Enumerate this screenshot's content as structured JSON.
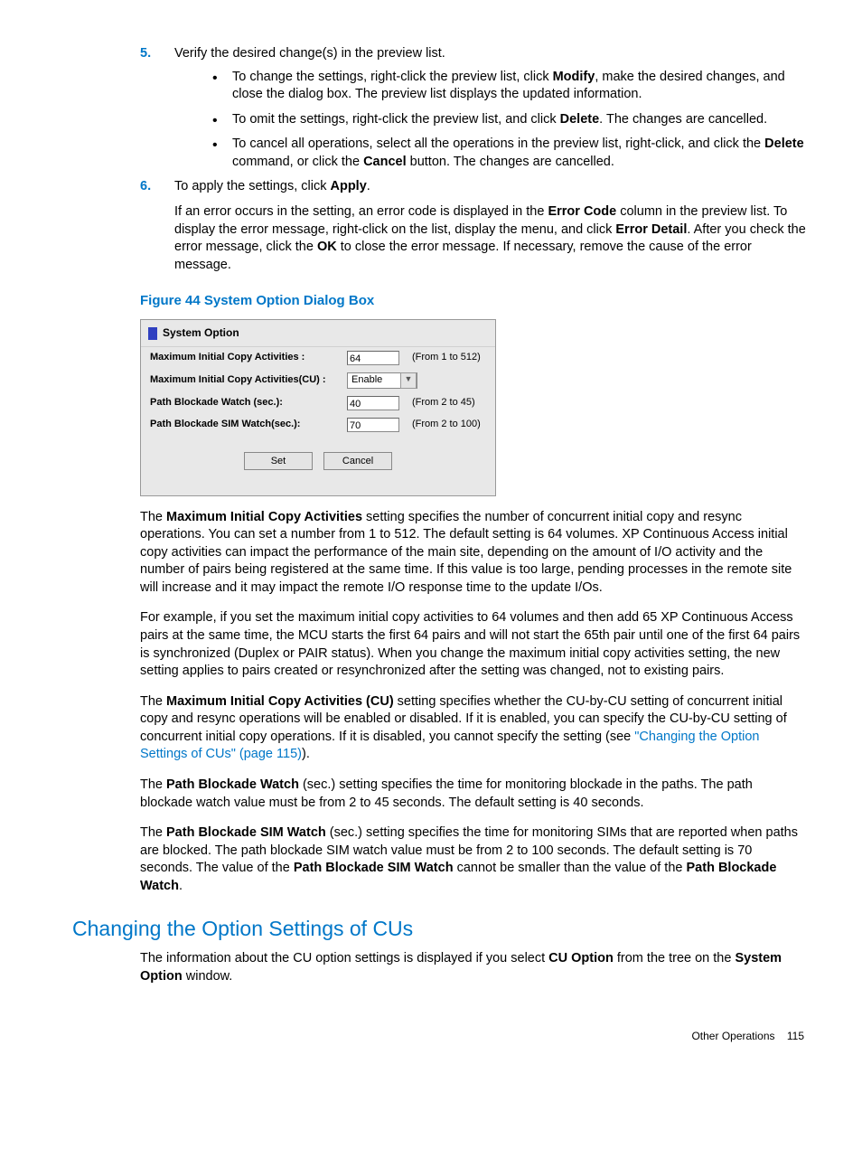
{
  "steps": {
    "s5": {
      "num": "5.",
      "text": "Verify the desired change(s) in the preview list.",
      "bullets": [
        {
          "pre": "To change the settings, right-click the preview list, click ",
          "b1": "Modify",
          "post": ", make the desired changes, and close the dialog box. The preview list displays the updated information."
        },
        {
          "pre": "To omit the settings, right-click the preview list, and click ",
          "b1": "Delete",
          "post": ". The changes are cancelled."
        },
        {
          "pre": "To cancel all operations, select all the operations in the preview list, right-click, and click the ",
          "b1": "Delete",
          "mid": " command, or click the ",
          "b2": "Cancel",
          "post": " button. The changes are cancelled."
        }
      ]
    },
    "s6": {
      "num": "6.",
      "pre": "To apply the settings, click ",
      "b1": "Apply",
      "post": ".",
      "extraA": "If an error occurs in the setting, an error code is displayed in the ",
      "extraB": "Error Code",
      "extraC": " column in the preview list. To display the error message, right-click on the list, display the menu, and click ",
      "extraD": "Error Detail",
      "extraE": ". After you check the error message, click the ",
      "extraF": "OK",
      "extraG": " to close the error message. If necessary, remove the cause of the error message."
    }
  },
  "figure": {
    "caption": "Figure 44 System Option Dialog Box",
    "title": "System Option",
    "rows": {
      "r1": {
        "label": "Maximum Initial Copy Activities :",
        "value": "64",
        "range": "(From 1 to 512)"
      },
      "r2": {
        "label": "Maximum Initial Copy Activities(CU) :",
        "value": "Enable"
      },
      "r3": {
        "label": "Path Blockade Watch (sec.):",
        "value": "40",
        "range": "(From 2 to 45)"
      },
      "r4": {
        "label": "Path Blockade SIM Watch(sec.):",
        "value": "70",
        "range": "(From 2 to 100)"
      }
    },
    "btn_set": "Set",
    "btn_cancel": "Cancel"
  },
  "paras": {
    "p1a": "The ",
    "p1b": "Maximum Initial Copy Activities",
    "p1c": " setting specifies the number of concurrent initial copy and resync operations. You can set a number from 1 to 512. The default setting is 64 volumes. XP Continuous Access initial copy activities can impact the performance of the main site, depending on the amount of I/O activity and the number of pairs being registered at the same time. If this value is too large, pending processes in the remote site will increase and it may impact the remote I/O response time to the update I/Os.",
    "p2": "For example, if you set the maximum initial copy activities to 64 volumes and then add 65 XP Continuous Access pairs at the same time, the MCU starts the first 64 pairs and will not start the 65th pair until one of the first 64 pairs is synchronized (Duplex or PAIR status). When you change the maximum initial copy activities setting, the new setting applies to pairs created or resynchronized after the setting was changed, not to existing pairs.",
    "p3a": "The ",
    "p3b": "Maximum Initial Copy Activities (CU)",
    "p3c": " setting specifies whether the CU-by-CU setting of concurrent initial copy and resync operations will be enabled or disabled. If it is enabled, you can specify the CU-by-CU setting of concurrent initial copy operations. If it is disabled, you cannot specify the setting (see ",
    "p3link": "\"Changing the Option Settings of CUs\" (page 115)",
    "p3d": ").",
    "p4a": "The ",
    "p4b": "Path Blockade Watch",
    "p4c": " (sec.) setting specifies the time for monitoring blockade in the paths. The path blockade watch value must be from 2 to 45 seconds. The default setting is 40 seconds.",
    "p5a": "The ",
    "p5b": "Path Blockade SIM Watch",
    "p5c": " (sec.) setting specifies the time for monitoring SIMs that are reported when paths are blocked. The path blockade SIM watch value must be from 2 to 100 seconds. The default setting is 70 seconds. The value of the ",
    "p5d": "Path Blockade SIM Watch",
    "p5e": " cannot be smaller than the value of the ",
    "p5f": "Path Blockade Watch",
    "p5g": "."
  },
  "section": {
    "title": "Changing the Option Settings of CUs",
    "p1a": "The information about the CU option settings is displayed if you select ",
    "p1b": "CU Option",
    "p1c": " from the tree on the ",
    "p1d": "System Option",
    "p1e": " window."
  },
  "footer": {
    "left": "Other Operations",
    "pageno": "115"
  }
}
